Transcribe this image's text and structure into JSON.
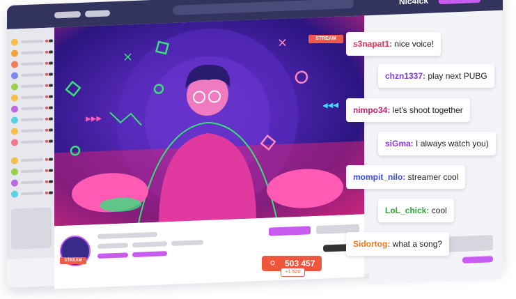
{
  "header": {
    "username": "Nic4ick"
  },
  "video": {
    "stream_label": "STREAM"
  },
  "streamer": {
    "badge": "STREAM"
  },
  "viewers": {
    "count": "503 457",
    "delta": "+1 520"
  },
  "chat": [
    {
      "nick": "s3napat1:",
      "text": " nice voice!",
      "color": "#e0325a"
    },
    {
      "nick": "chzn1337:",
      "text": " play next PUBG",
      "color": "#7a3ae0"
    },
    {
      "nick": "nimpo34:",
      "text": " let's shoot together",
      "color": "#c0256a"
    },
    {
      "nick": "siGma:",
      "text": " I always watch you)",
      "color": "#8a35d8"
    },
    {
      "nick": "mompit_nilo:",
      "text": " streamer cool",
      "color": "#3a4ad8"
    },
    {
      "nick": "LoL_chick:",
      "text": " cool",
      "color": "#2aa63a"
    },
    {
      "nick": "Sidortog:",
      "text": " what a song?",
      "color": "#f07a1a"
    }
  ],
  "colors": {
    "accent": "#c85cf0",
    "topbar": "#33345e",
    "live": "#f05a4a"
  }
}
